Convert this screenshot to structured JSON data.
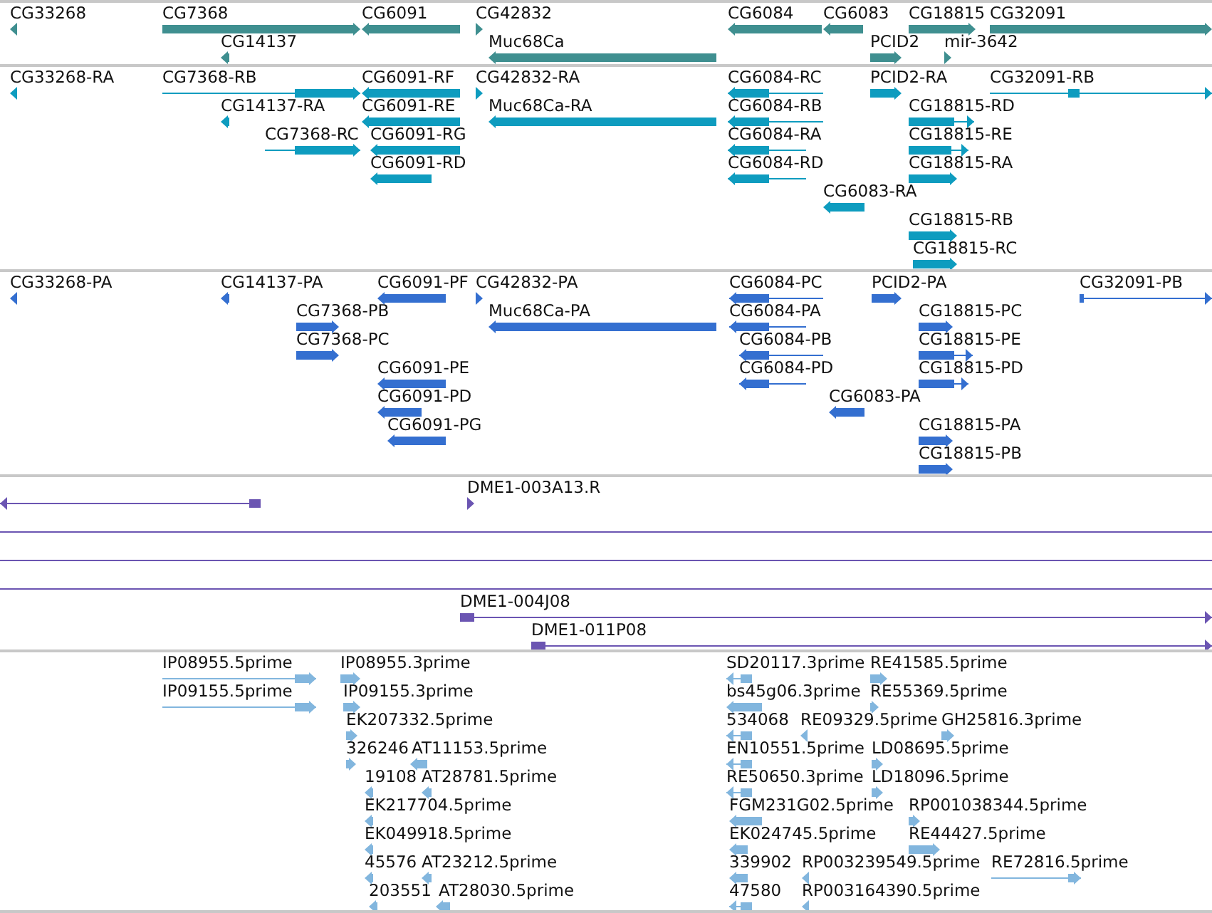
{
  "tracks": [
    {
      "color": "#3f8f90",
      "features": [
        {
          "label": "CG33268",
          "reverse": true
        },
        {
          "label": "CG7368",
          "reverse": false
        },
        {
          "label": "CG6091",
          "reverse": true
        },
        {
          "label": "CG42832",
          "reverse": false
        },
        {
          "label": "CG6084",
          "reverse": true
        },
        {
          "label": "CG6083",
          "reverse": true
        },
        {
          "label": "CG18815",
          "reverse": false
        },
        {
          "label": "CG32091",
          "reverse": false
        },
        {
          "label": "CG14137",
          "reverse": true
        },
        {
          "label": "Muc68Ca",
          "reverse": true
        },
        {
          "label": "PCID2",
          "reverse": false
        },
        {
          "label": "mir-3642",
          "reverse": false
        }
      ]
    },
    {
      "color": "#0e9cbf",
      "features": [
        {
          "label": "CG33268-RA",
          "reverse": true
        },
        {
          "label": "CG7368-RB",
          "reverse": false
        },
        {
          "label": "CG6091-RF",
          "reverse": true
        },
        {
          "label": "CG42832-RA",
          "reverse": false
        },
        {
          "label": "CG6084-RC",
          "reverse": true
        },
        {
          "label": "PCID2-RA",
          "reverse": false
        },
        {
          "label": "CG32091-RB",
          "reverse": false
        },
        {
          "label": "CG14137-RA",
          "reverse": true
        },
        {
          "label": "CG6091-RE",
          "reverse": true
        },
        {
          "label": "Muc68Ca-RA",
          "reverse": true
        },
        {
          "label": "CG6084-RB",
          "reverse": true
        },
        {
          "label": "CG18815-RD",
          "reverse": false
        },
        {
          "label": "CG7368-RC",
          "reverse": false
        },
        {
          "label": "CG6091-RG",
          "reverse": true
        },
        {
          "label": "CG6084-RA",
          "reverse": true
        },
        {
          "label": "CG18815-RE",
          "reverse": false
        },
        {
          "label": "CG6091-RD",
          "reverse": true
        },
        {
          "label": "CG6084-RD",
          "reverse": true
        },
        {
          "label": "CG18815-RA",
          "reverse": false
        },
        {
          "label": "CG6083-RA",
          "reverse": true
        },
        {
          "label": "CG18815-RB",
          "reverse": false
        },
        {
          "label": "CG18815-RC",
          "reverse": false
        }
      ]
    },
    {
      "color": "#346fd0",
      "features": [
        {
          "label": "CG33268-PA",
          "reverse": true
        },
        {
          "label": "CG14137-PA",
          "reverse": true
        },
        {
          "label": "CG6091-PF",
          "reverse": true
        },
        {
          "label": "CG42832-PA",
          "reverse": false
        },
        {
          "label": "CG6084-PC",
          "reverse": true
        },
        {
          "label": "PCID2-PA",
          "reverse": false
        },
        {
          "label": "CG32091-PB",
          "reverse": false
        },
        {
          "label": "CG7368-PB",
          "reverse": false
        },
        {
          "label": "Muc68Ca-PA",
          "reverse": true
        },
        {
          "label": "CG6084-PA",
          "reverse": true
        },
        {
          "label": "CG18815-PC",
          "reverse": false
        },
        {
          "label": "CG7368-PC",
          "reverse": false
        },
        {
          "label": "CG6084-PB",
          "reverse": true
        },
        {
          "label": "CG18815-PE",
          "reverse": false
        },
        {
          "label": "CG6091-PE",
          "reverse": true
        },
        {
          "label": "CG6084-PD",
          "reverse": true
        },
        {
          "label": "CG18815-PD",
          "reverse": false
        },
        {
          "label": "CG6091-PD",
          "reverse": true
        },
        {
          "label": "CG6083-PA",
          "reverse": true
        },
        {
          "label": "CG6091-PG",
          "reverse": true
        },
        {
          "label": "CG18815-PA",
          "reverse": false
        },
        {
          "label": "CG18815-PB",
          "reverse": false
        }
      ]
    },
    {
      "color": "#6b55b2",
      "features": [
        {
          "label": "DME1-003A13.R",
          "reverse": false
        },
        {
          "label": "DME1-004J08",
          "reverse": false
        },
        {
          "label": "DME1-011P08",
          "reverse": false
        }
      ]
    },
    {
      "color": "#82b6de",
      "features": [
        {
          "label": "IP08955.5prime",
          "reverse": false
        },
        {
          "label": "IP08955.3prime",
          "reverse": false
        },
        {
          "label": "SD20117.3prime",
          "reverse": true
        },
        {
          "label": "RE41585.5prime",
          "reverse": false
        },
        {
          "label": "IP09155.5prime",
          "reverse": false
        },
        {
          "label": "IP09155.3prime",
          "reverse": false
        },
        {
          "label": "bs45g06.3prime",
          "reverse": true
        },
        {
          "label": "RE55369.5prime",
          "reverse": false
        },
        {
          "label": "EK207332.5prime",
          "reverse": false
        },
        {
          "label": "534068",
          "reverse": true
        },
        {
          "label": "RE09329.5prime",
          "reverse": true
        },
        {
          "label": "GH25816.3prime",
          "reverse": false
        },
        {
          "label": "326246",
          "reverse": false
        },
        {
          "label": "AT11153.5prime",
          "reverse": true
        },
        {
          "label": "EN10551.5prime",
          "reverse": true
        },
        {
          "label": "LD08695.5prime",
          "reverse": false
        },
        {
          "label": "19108",
          "reverse": true
        },
        {
          "label": "AT28781.5prime",
          "reverse": true
        },
        {
          "label": "RE50650.3prime",
          "reverse": true
        },
        {
          "label": "LD18096.5prime",
          "reverse": false
        },
        {
          "label": "EK217704.5prime",
          "reverse": true
        },
        {
          "label": "FGM231G02.5prime",
          "reverse": true
        },
        {
          "label": "RP001038344.5prime",
          "reverse": false
        },
        {
          "label": "EK049918.5prime",
          "reverse": true
        },
        {
          "label": "EK024745.5prime",
          "reverse": true
        },
        {
          "label": "RE44427.5prime",
          "reverse": false
        },
        {
          "label": "45576",
          "reverse": true
        },
        {
          "label": "AT23212.5prime",
          "reverse": true
        },
        {
          "label": "339902",
          "reverse": true
        },
        {
          "label": "RP003239549.5prime",
          "reverse": true
        },
        {
          "label": "RE72816.5prime",
          "reverse": false
        },
        {
          "label": "203551",
          "reverse": true
        },
        {
          "label": "AT28030.5prime",
          "reverse": true
        },
        {
          "label": "47580",
          "reverse": true
        },
        {
          "label": "RP003164390.5prime",
          "reverse": true
        }
      ]
    }
  ]
}
